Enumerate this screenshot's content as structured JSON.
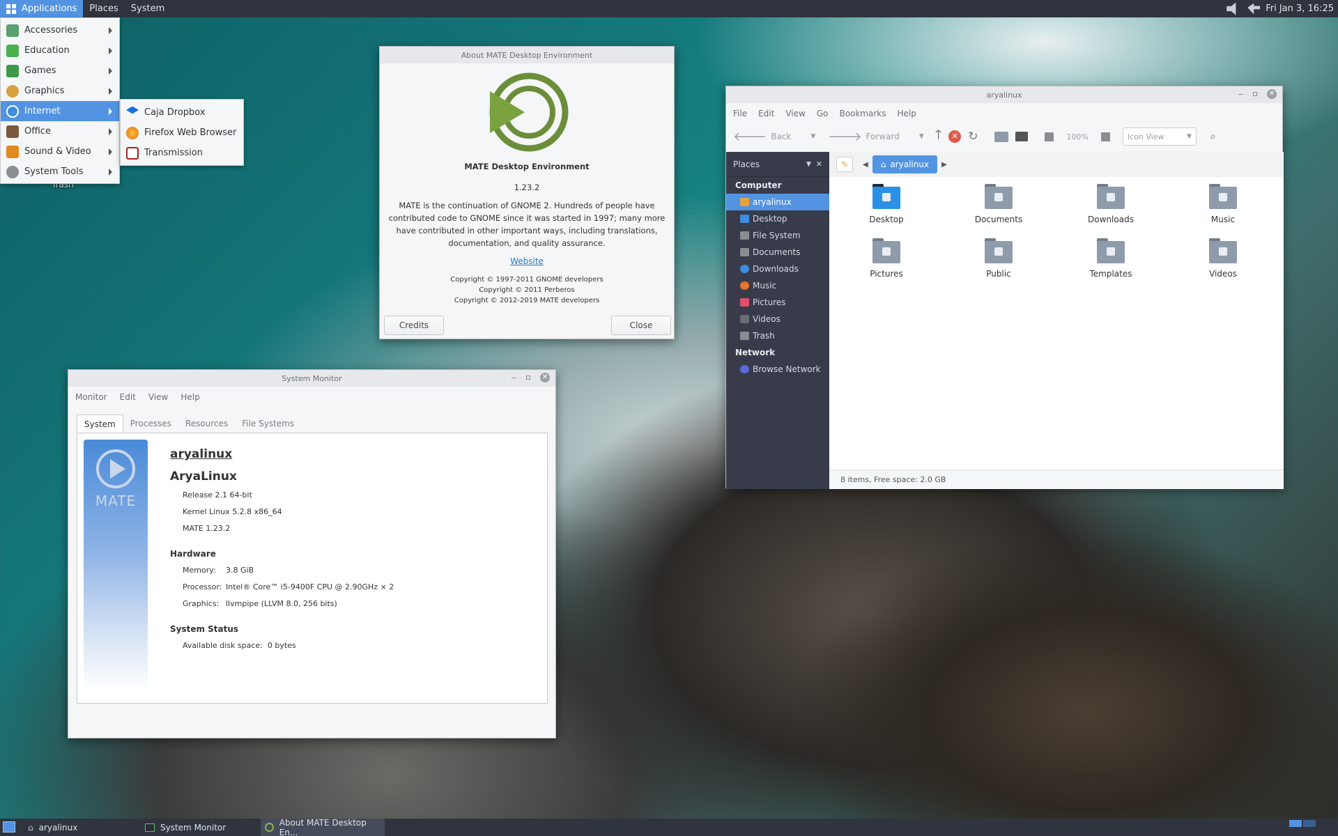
{
  "top_panel": {
    "applications": "Applications",
    "places": "Places",
    "system": "System",
    "clock": "Fri Jan  3, 16:25"
  },
  "apps_menu": [
    {
      "label": "Accessories",
      "icon": "accessories-icon",
      "color": "#5aa070"
    },
    {
      "label": "Education",
      "icon": "education-icon",
      "color": "#4caf50"
    },
    {
      "label": "Games",
      "icon": "games-icon",
      "color": "#3a9a4a"
    },
    {
      "label": "Graphics",
      "icon": "graphics-icon",
      "color": "#d9a040"
    },
    {
      "label": "Internet",
      "icon": "internet-icon",
      "color": "#3d8ee0"
    },
    {
      "label": "Office",
      "icon": "office-icon",
      "color": "#7a5a3a"
    },
    {
      "label": "Sound & Video",
      "icon": "sound-video-icon",
      "color": "#e08a20"
    },
    {
      "label": "System Tools",
      "icon": "system-tools-icon",
      "color": "#8a8e93"
    }
  ],
  "internet_submenu": [
    {
      "label": "Caja Dropbox",
      "icon": "dropbox-icon",
      "color": "#1a6fe0"
    },
    {
      "label": "Firefox Web Browser",
      "icon": "firefox-icon",
      "color": "#e86a1a"
    },
    {
      "label": "Transmission",
      "icon": "transmission-icon",
      "color": "#b02020"
    }
  ],
  "desktop": {
    "trash_label": "Trash"
  },
  "about": {
    "title": "About MATE Desktop Environment",
    "name": "MATE Desktop Environment",
    "version": "1.23.2",
    "description": "MATE is the continuation of GNOME 2. Hundreds of people have contributed code to GNOME since it was started in 1997; many more have contributed in other important ways, including translations, documentation, and quality assurance.",
    "website": "Website",
    "copyright1": "Copyright © 1997-2011 GNOME developers",
    "copyright2": "Copyright © 2011 Perberos",
    "copyright3": "Copyright © 2012-2019 MATE developers",
    "credits_button": "Credits",
    "close_button": "Close"
  },
  "sysmon": {
    "title": "System Monitor",
    "menu": [
      "Monitor",
      "Edit",
      "View",
      "Help"
    ],
    "tabs": [
      "System",
      "Processes",
      "Resources",
      "File Systems"
    ],
    "banner_text": "MATE",
    "hostname": "aryalinux",
    "distro": "AryaLinux",
    "release": "Release 2.1 64-bit",
    "kernel": "Kernel Linux 5.2.8 x86_64",
    "mate": "MATE 1.23.2",
    "hardware_heading": "Hardware",
    "memory_label": "Memory:",
    "memory_value": "3.8 GiB",
    "processor_label": "Processor:",
    "processor_value": "Intel® Core™ i5-9400F CPU @ 2.90GHz × 2",
    "graphics_label": "Graphics:",
    "graphics_value": "llvmpipe (LLVM 8.0, 256 bits)",
    "status_heading": "System Status",
    "disk_label": "Available disk space:",
    "disk_value": "0 bytes"
  },
  "caja": {
    "title": "aryalinux",
    "menu": [
      "File",
      "Edit",
      "View",
      "Go",
      "Bookmarks",
      "Help"
    ],
    "back": "Back",
    "forward": "Forward",
    "zoom": "100%",
    "view_mode": "Icon View",
    "places_label": "Places",
    "computer_heading": "Computer",
    "places": [
      {
        "label": "aryalinux",
        "color": "#e9a23b"
      },
      {
        "label": "Desktop",
        "color": "#3d8ee0"
      },
      {
        "label": "File System",
        "color": "#8a8e93"
      },
      {
        "label": "Documents",
        "color": "#8a8e93"
      },
      {
        "label": "Downloads",
        "color": "#3d8ee0"
      },
      {
        "label": "Music",
        "color": "#e8742c"
      },
      {
        "label": "Pictures",
        "color": "#e0506a"
      },
      {
        "label": "Videos",
        "color": "#6a6e73"
      },
      {
        "label": "Trash",
        "color": "#8a8e93"
      }
    ],
    "network_heading": "Network",
    "browse_network": "Browse Network",
    "path_current": "aryalinux",
    "files": [
      "Desktop",
      "Documents",
      "Downloads",
      "Music",
      "Pictures",
      "Public",
      "Templates",
      "Videos"
    ],
    "status": "8 items, Free space: 2.0 GB"
  },
  "bottom_panel": {
    "tasks": [
      "aryalinux",
      "System Monitor",
      "About MATE Desktop En..."
    ]
  }
}
